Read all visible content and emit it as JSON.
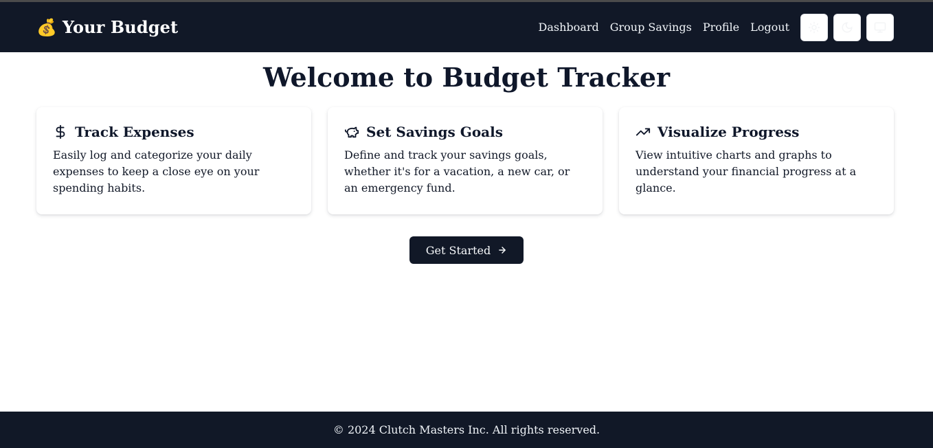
{
  "brand": {
    "emoji": "💰",
    "title": "Your Budget"
  },
  "nav": {
    "links": [
      "Dashboard",
      "Group Savings",
      "Profile",
      "Logout"
    ],
    "icons": [
      "sun-icon",
      "moon-icon",
      "monitor-icon"
    ]
  },
  "hero": {
    "title": "Welcome to Budget Tracker"
  },
  "cards": [
    {
      "icon": "dollar-icon",
      "title": "Track Expenses",
      "description": "Easily log and categorize your daily expenses to keep a close eye on your spending habits."
    },
    {
      "icon": "piggy-bank-icon",
      "title": "Set Savings Goals",
      "description": "Define and track your savings goals, whether it's for a vacation, a new car, or an emergency fund."
    },
    {
      "icon": "trending-up-icon",
      "title": "Visualize Progress",
      "description": "View intuitive charts and graphs to understand your financial progress at a glance."
    }
  ],
  "cta": {
    "label": "Get Started",
    "icon": "arrow-right-icon"
  },
  "footer": {
    "text": "© 2024 Clutch Masters Inc. All rights reserved."
  },
  "colors": {
    "navbar_bg": "#111827",
    "button_bg": "#111827",
    "text": "#0f172a"
  }
}
